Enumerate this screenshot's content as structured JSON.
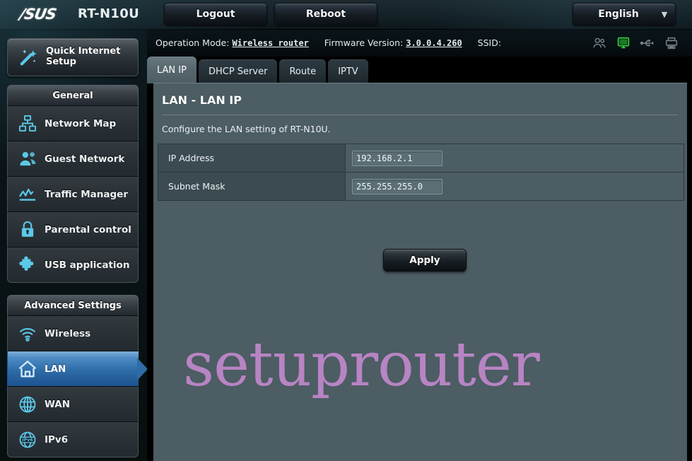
{
  "header": {
    "brand": "/SUS",
    "model": "RT-N10U",
    "logout_label": "Logout",
    "reboot_label": "Reboot",
    "language": "English",
    "caret": "▼"
  },
  "status": {
    "operation_mode_label": "Operation Mode:",
    "operation_mode_value": "Wireless router",
    "firmware_label": "Firmware Version:",
    "firmware_value": "3.0.0.4.260",
    "ssid_label": "SSID:",
    "ssid_value": "",
    "icons": [
      {
        "name": "guest-network-icon",
        "active": false
      },
      {
        "name": "connected-client-icon",
        "active": true
      },
      {
        "name": "usb-icon",
        "active": false
      },
      {
        "name": "printer-icon",
        "active": false
      }
    ]
  },
  "sidebar": {
    "quick_setup_label": "Quick Internet Setup",
    "general_header": "General",
    "general_items": [
      {
        "label": "Network Map",
        "icon": "network-map-icon"
      },
      {
        "label": "Guest Network",
        "icon": "guest-network-icon"
      },
      {
        "label": "Traffic Manager",
        "icon": "traffic-manager-icon"
      },
      {
        "label": "Parental control",
        "icon": "lock-icon"
      },
      {
        "label": "USB application",
        "icon": "puzzle-icon"
      }
    ],
    "advanced_header": "Advanced Settings",
    "advanced_items": [
      {
        "label": "Wireless",
        "icon": "wifi-icon",
        "active": false
      },
      {
        "label": "LAN",
        "icon": "home-icon",
        "active": true
      },
      {
        "label": "WAN",
        "icon": "globe-icon",
        "active": false
      },
      {
        "label": "IPv6",
        "icon": "ipv6-icon",
        "active": false
      }
    ]
  },
  "main": {
    "tabs": [
      {
        "label": "LAN IP",
        "active": true
      },
      {
        "label": "DHCP Server",
        "active": false
      },
      {
        "label": "Route",
        "active": false
      },
      {
        "label": "IPTV",
        "active": false
      }
    ],
    "panel_title": "LAN - LAN IP",
    "panel_description": "Configure the LAN setting of RT-N10U.",
    "fields": [
      {
        "label": "IP Address",
        "value": "192.168.2.1"
      },
      {
        "label": "Subnet Mask",
        "value": "255.255.255.0"
      }
    ],
    "apply_label": "Apply",
    "watermark": "setuprouter"
  },
  "colors": {
    "accent_blue": "#2d6ca8",
    "icon_cyan": "#5cc8e8",
    "panel_bg": "#4c5d63",
    "label_bg": "#3c4b51",
    "watermark": "#b884c4",
    "status_green": "#2fd13a"
  }
}
